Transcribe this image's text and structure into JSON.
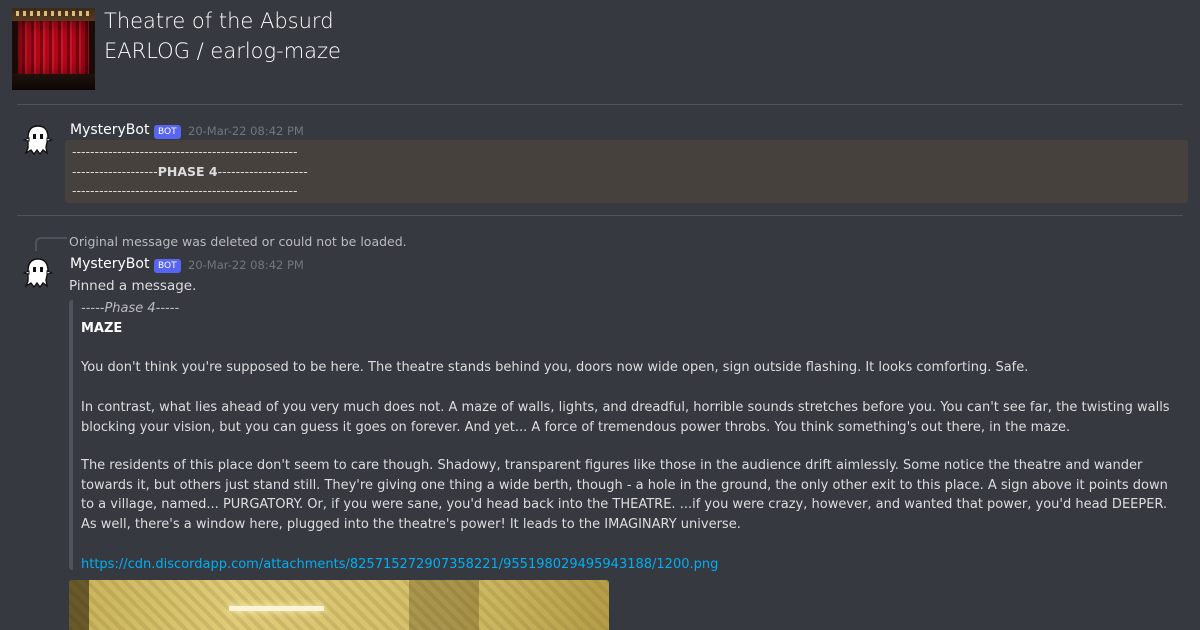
{
  "header": {
    "server_name": "Theatre of the Absurd",
    "channel_path": "EARLOG / earlog-maze",
    "icon": "theatre-curtain-server-icon"
  },
  "messages": [
    {
      "author": "MysteryBot",
      "bot_tag": "BOT",
      "timestamp": "20-Mar-22 08:42 PM",
      "code_lines": [
        "--------------------------------------------------",
        "-------------------",
        "PHASE 4",
        "--------------------",
        "--------------------------------------------------"
      ]
    },
    {
      "reply_notice": "Original message was deleted or could not be loaded.",
      "author": "MysteryBot",
      "bot_tag": "BOT",
      "timestamp": "20-Mar-22 08:42 PM",
      "text": "Pinned a message.",
      "embed": {
        "phase_title": "-----Phase 4-----",
        "title": "MAZE",
        "paragraphs": [
          "You don't think you're supposed to be here. The theatre stands behind you, doors now wide open, sign outside flashing. It looks comforting. Safe.",
          "In contrast, what lies ahead of you very much does not. A maze of walls, lights, and dreadful, horrible sounds stretches before you. You can't see far, the twisting walls blocking your vision, but you can guess it goes on forever. And yet... A force of tremendous power throbs. You think something's out there, in the maze.",
          "The residents of this place don't seem to care though. Shadowy, transparent figures like those in the audience drift aimlessly. Some notice the theatre and wander towards it, but others just stand still. They're giving one thing a wide berth, though - a hole in the ground, the only other exit to this place. A sign above it points down to a village, named... PURGATORY. Or, if you were sane, you'd head back into the THEATRE. ...if you were crazy, however, and wanted that power, you'd head DEEPER. As well, there's a window here, plugged into the theatre's power! It leads to the IMAGINARY universe."
        ],
        "link": "https://cdn.discordapp.com/attachments/825715272907358221/955198029495943188/1200.png"
      }
    }
  ],
  "colors": {
    "background": "#36393f",
    "bot_tag": "#5865f2",
    "link": "#00aff4",
    "code_block": "#46413d"
  }
}
